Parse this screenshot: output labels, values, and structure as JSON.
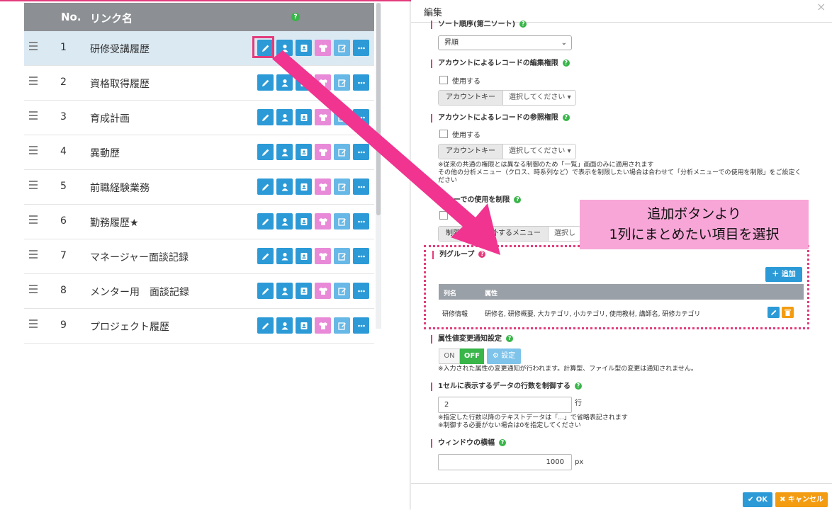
{
  "table": {
    "header": {
      "no": "No.",
      "name": "リンク名",
      "help": "?"
    },
    "rows": [
      {
        "no": "1",
        "name": "研修受講履歴"
      },
      {
        "no": "2",
        "name": "資格取得履歴"
      },
      {
        "no": "3",
        "name": "育成計画"
      },
      {
        "no": "4",
        "name": "異動歴"
      },
      {
        "no": "5",
        "name": "前職経験業務"
      },
      {
        "no": "6",
        "name": "勤務履歴★"
      },
      {
        "no": "7",
        "name": "マネージャー面談記録"
      },
      {
        "no": "8",
        "name": "メンター用　面談記録"
      },
      {
        "no": "9",
        "name": "プロジェクト履歴"
      }
    ],
    "action_icons": [
      "edit-icon",
      "user-icon",
      "id-card-icon",
      "shirt-icon",
      "edit-note-icon",
      "more-icon"
    ]
  },
  "dialog": {
    "title": "編集",
    "close": "×",
    "sort_order": {
      "label": "ソート順序(第二ソート)",
      "value": "昇順"
    },
    "edit_perm": {
      "label": "アカウントによるレコードの編集権限",
      "use": "使用する",
      "key": "アカウントキー",
      "select": "選択してください"
    },
    "view_perm": {
      "label": "アカウントによるレコードの参照権限",
      "use": "使用する",
      "key": "アカウントキー",
      "select": "選択してください",
      "note1": "※従来の共通の権限とは異なる制御のため「一覧」画面のみに適用されます",
      "note2": "その他の分析メニュー（クロス、時系列など）で表示を制限したい場合は合わせて「分析メニューでの使用を制限」をご設定く",
      "note3": "ださい"
    },
    "menu_limit": {
      "label_fragment": "ニューでの使用を制限",
      "key_fragment_a": "制限の対",
      "key_fragment_b": "外するメニュー",
      "select_fragment": "選択し"
    },
    "callout": {
      "line1": "追加ボタンより",
      "line2": "1列にまとめたい項目を選択"
    },
    "column_group": {
      "label": "列グループ",
      "add_button": "＋ 追加",
      "headers": {
        "col": "列名",
        "attr": "属性"
      },
      "rows": [
        {
          "col": "研修情報",
          "attr": "研修名, 研修概要, 大カテゴリ, 小カテゴリ, 使用教材, 講師名, 研修カテゴリ"
        }
      ]
    },
    "attr_notify": {
      "label": "属性値変更通知設定",
      "on": "ON",
      "off": "OFF",
      "settings": "⚙ 設定",
      "note": "※入力された属性の変更通知が行われます。計算型、ファイル型の変更は通知されません。"
    },
    "row_limit": {
      "label": "1セルに表示するデータの行数を制御する",
      "value": "2",
      "unit": "行",
      "note1": "※指定した行数以降のテキストデータは「...」で省略表記されます",
      "note2": "※制御する必要がない場合は0を指定してください"
    },
    "window_width": {
      "label": "ウィンドウの横幅",
      "value": "1000",
      "unit": "px"
    },
    "footer": {
      "ok": "✔ OK",
      "cancel": "✖ キャンセル"
    }
  },
  "colors": {
    "accent_pink": "#e33c7c",
    "button_blue": "#2c9ad6",
    "green": "#39b54a",
    "orange": "#f39c12"
  }
}
